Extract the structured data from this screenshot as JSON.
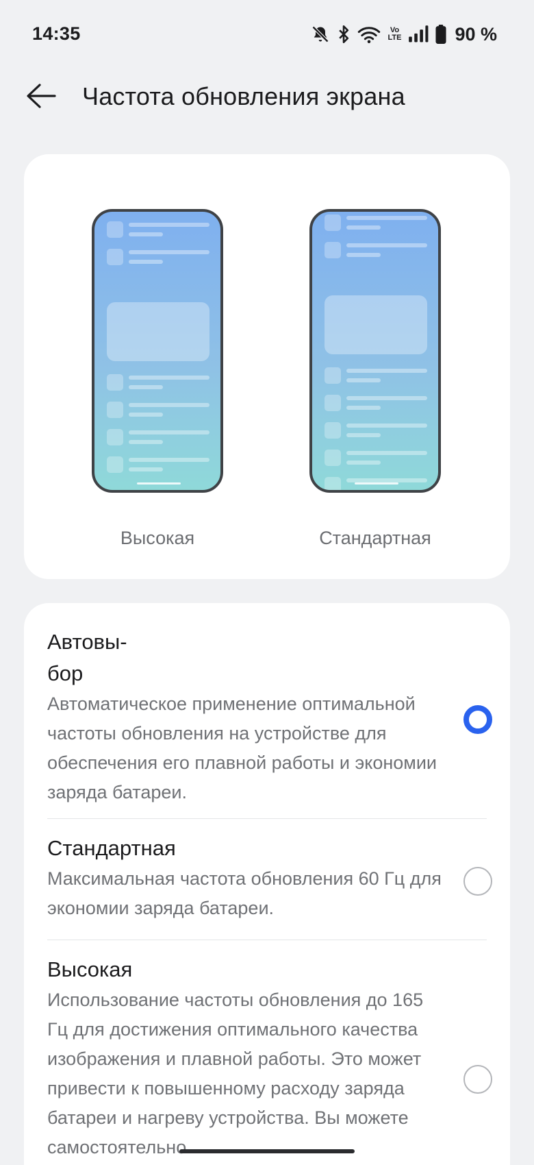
{
  "status_bar": {
    "time": "14:35",
    "battery_percent": "90 %",
    "icons": [
      "bell-off-icon",
      "bluetooth-icon",
      "wifi-icon",
      "volte-icon",
      "signal-icon",
      "battery-icon"
    ],
    "volte_top": "Vo",
    "volte_bottom": "LTE"
  },
  "header": {
    "back_icon": "arrow-left-icon",
    "title": "Частота обновления экрана"
  },
  "preview": {
    "left_label": "Высокая",
    "right_label": "Стандартная"
  },
  "options": [
    {
      "title": "Автовы-\nбор",
      "description": "Автоматическое применение оптимальной частоты обновления на устройстве для обеспечения его плавной работы и экономии заряда батареи.",
      "selected": true
    },
    {
      "title": "Стандартная",
      "description": "Максимальная частота обновления 60 Гц для экономии заряда батареи.",
      "selected": false
    },
    {
      "title": "Высокая",
      "description": "Использование частоты обновления до 165 Гц для достижения оптимального качества изображения и плавной работы. Это может привести к повышенному расходу заряда батареи и нагреву устройства. Вы можете самостоятельно",
      "selected": false
    }
  ],
  "colors": {
    "accent": "#2a62ee",
    "background": "#f0f1f3",
    "card": "#ffffff"
  }
}
